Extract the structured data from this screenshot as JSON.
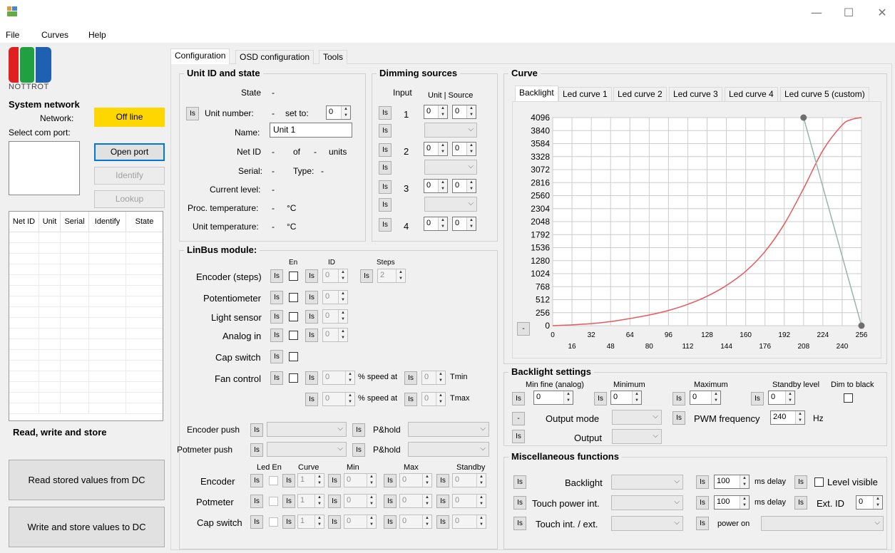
{
  "window": {
    "minimize": "—",
    "maximize": "☐",
    "close": "✕"
  },
  "menu": [
    "File",
    "Curves",
    "Help"
  ],
  "logo_text": "NOTTROT",
  "sidebar": {
    "title": "System network",
    "network_label": "Network:",
    "network_status": "Off line",
    "select_com_label": "Select com port:",
    "open_port": "Open port",
    "identify": "Identify",
    "lookup": "Lookup",
    "table_headers": [
      "Net ID",
      "Unit",
      "Serial",
      "Identify",
      "State"
    ],
    "rws_title": "Read, write and store",
    "read_btn": "Read stored values from DC",
    "write_btn": "Write and store values to DC"
  },
  "tabs": [
    "Configuration",
    "OSD configuration",
    "Tools"
  ],
  "is": "Is",
  "unit": {
    "title": "Unit ID and state",
    "state_label": "State",
    "dash": "-",
    "unit_number_label": "Unit number:",
    "set_to": "set to:",
    "set_to_value": "0",
    "name_label": "Name:",
    "name_value": "Unit 1",
    "netid_label": "Net ID",
    "of": "of",
    "units": "units",
    "serial_label": "Serial:",
    "type_label": "Type:",
    "current_level_label": "Current level:",
    "proc_temp_label": "Proc. temperature:",
    "unit_temp_label": "Unit temperature:",
    "deg": "°C"
  },
  "dimming": {
    "title": "Dimming sources",
    "input_label": "Input",
    "unit_source_label": "Unit | Source",
    "inputs": [
      "1",
      "2",
      "3",
      "4"
    ],
    "zero": "0"
  },
  "linbus": {
    "title": "LinBus module:",
    "en": "En",
    "id": "ID",
    "steps": "Steps",
    "encoder": "Encoder (steps)",
    "potentiometer": "Potentiometer",
    "light_sensor": "Light sensor",
    "analog_in": "Analog in",
    "cap_switch": "Cap switch",
    "fan_control": "Fan control",
    "pct_speed_at": "% speed at",
    "tmin": "Tmin",
    "tmax": "Tmax",
    "zero": "0",
    "two": "2",
    "encoder_push": "Encoder push",
    "potmeter_push": "Potmeter push",
    "phold": "P&hold",
    "led_en": "Led En",
    "curve": "Curve",
    "min": "Min",
    "max": "Max",
    "standby": "Standby",
    "encoder2": "Encoder",
    "potmeter2": "Potmeter",
    "cap_switch2": "Cap switch",
    "one": "1"
  },
  "curve": {
    "title": "Curve",
    "tabs": [
      "Backlight",
      "Led curve 1",
      "Led curve 2",
      "Led curve 3",
      "Led curve 4",
      "Led curve 5 (custom)"
    ],
    "minus": "-"
  },
  "chart_data": {
    "type": "line",
    "x_ticks_upper": [
      "0",
      "32",
      "64",
      "96",
      "128",
      "160",
      "192",
      "224",
      "256"
    ],
    "x_ticks_lower": [
      "16",
      "48",
      "80",
      "112",
      "144",
      "176",
      "208",
      "240"
    ],
    "y_ticks": [
      "4096",
      "3840",
      "3584",
      "3328",
      "3072",
      "2816",
      "2560",
      "2304",
      "2048",
      "1792",
      "1536",
      "1280",
      "1024",
      "768",
      "512",
      "256",
      "0"
    ],
    "xlim": [
      0,
      256
    ],
    "ylim": [
      0,
      4096
    ],
    "grid": true,
    "series": [
      {
        "color": "#e8585c",
        "x": [
          0,
          16,
          32,
          48,
          64,
          80,
          96,
          112,
          128,
          144,
          160,
          176,
          192,
          208,
          224,
          240,
          248,
          256
        ],
        "y": [
          0,
          16,
          40,
          80,
          140,
          210,
          300,
          420,
          580,
          790,
          1070,
          1460,
          2000,
          2700,
          3450,
          3950,
          4060,
          4096
        ]
      },
      {
        "color": "#9bb5a8",
        "x": [
          208,
          256
        ],
        "y": [
          4096,
          0
        ]
      }
    ],
    "points": [
      {
        "x": 208,
        "y": 4096
      },
      {
        "x": 256,
        "y": 0
      }
    ]
  },
  "backlight": {
    "title": "Backlight settings",
    "min_fine": "Min fine (analog)",
    "minimum": "Minimum",
    "maximum": "Maximum",
    "standby_level": "Standby level",
    "dim_to_black": "Dim to black",
    "zero": "0",
    "output_mode": "Output mode",
    "pwm_freq": "PWM frequency",
    "pwm_value": "240",
    "hz": "Hz",
    "output": "Output",
    "minus": "-"
  },
  "misc": {
    "title": "Miscellaneous functions",
    "backlight": "Backlight",
    "touch_power": "Touch power int.",
    "touch_int_ext": "Touch int. / ext.",
    "hundred": "100",
    "ms_delay": "ms delay",
    "level_visible": "Level visible",
    "ext_id": "Ext. ID",
    "zero": "0",
    "power_on": "power on"
  }
}
